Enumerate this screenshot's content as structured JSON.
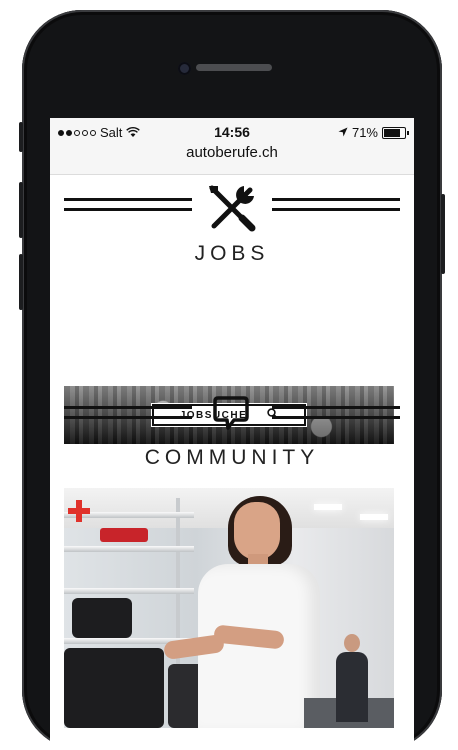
{
  "status_bar": {
    "carrier": "Salt",
    "signal_bars_filled": 2,
    "signal_bars_total": 5,
    "time": "14:56",
    "battery": "71%",
    "battery_level": 0.71,
    "url": "autoberufe.ch"
  },
  "jobs": {
    "icon": "tools-icon",
    "title": "JOBS",
    "search_label": "JOBSUCHE"
  },
  "community": {
    "icon": "speech-bubble-icon",
    "title": "COMMUNITY"
  },
  "colors": {
    "phone_body": "#131416",
    "rule": "#111111",
    "accent_red": "#e0322b"
  }
}
